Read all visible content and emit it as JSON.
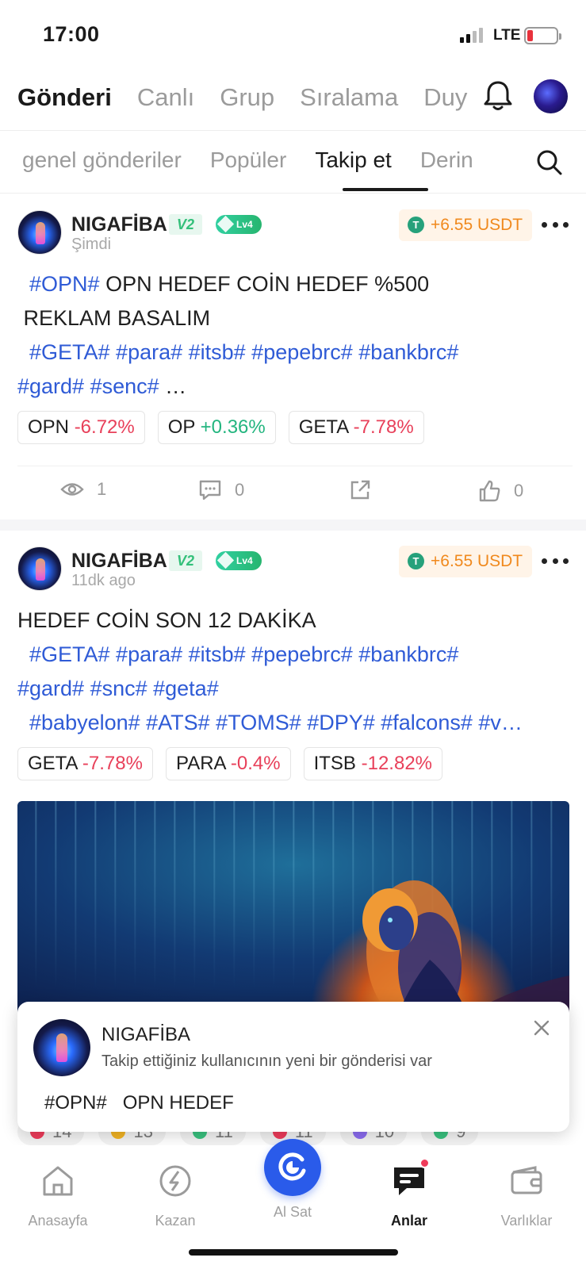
{
  "status_bar": {
    "time": "17:00",
    "network": "LTE"
  },
  "main_tabs": [
    "Gönderi",
    "Canlı",
    "Grup",
    "Sıralama",
    "Duy"
  ],
  "sub_tabs": [
    "genel gönderiler",
    "Popüler",
    "Takip et",
    "Derin"
  ],
  "colors": {
    "accent": "#2a5bea",
    "tag": "#2f5bd6",
    "negative": "#e8405a",
    "positive": "#23b57f",
    "reward": "#f0891d"
  },
  "posts": [
    {
      "author": "NIGAFİBA",
      "badge_v": "V2",
      "badge_lv": "Lv4",
      "time": "Şimdi",
      "reward": "+6.55 USDT",
      "lines": [
        {
          "tag": "#OPN#",
          "text": "   OPN HEDEF COİN HEDEF %500"
        },
        {
          "tag": "",
          "text": "REKLAM BASALIM"
        },
        {
          "tag": "#GETA# #para# #itsb# #pepebrc# #bankbrc#",
          "text": ""
        },
        {
          "tag": "#gard# #senc#",
          "text": "  …"
        }
      ],
      "chips": [
        {
          "symbol": "OPN",
          "change": "-6.72%",
          "direction": "negative"
        },
        {
          "symbol": "OP",
          "change": "+0.36%",
          "direction": "positive"
        },
        {
          "symbol": "GETA",
          "change": "-7.78%",
          "direction": "negative"
        }
      ],
      "views": "1",
      "comments": "0",
      "likes": "0"
    },
    {
      "author": "NIGAFİBA",
      "badge_v": "V2",
      "badge_lv": "Lv4",
      "time": "11dk ago",
      "reward": "+6.55 USDT",
      "lines": [
        {
          "tag": "",
          "text": "HEDEF COİN SON 12 DAKİKA"
        },
        {
          "tag": "#GETA# #para# #itsb# #pepebrc# #bankbrc#",
          "text": ""
        },
        {
          "tag": "#gard# #snc# #geta#",
          "text": ""
        },
        {
          "tag": "#babyelon# #ATS# #TOMS# #DPY# #falcons# #v…",
          "text": ""
        }
      ],
      "chips": [
        {
          "symbol": "GETA",
          "change": "-7.78%",
          "direction": "negative"
        },
        {
          "symbol": "PARA",
          "change": "-0.4%",
          "direction": "negative"
        },
        {
          "symbol": "ITSB",
          "change": "-12.82%",
          "direction": "negative"
        }
      ]
    }
  ],
  "notification": {
    "name": "NIGAFİBA",
    "message": "Takip ettiğiniz kullanıcının yeni bir gönderisi var",
    "snippet_tag": "#OPN#",
    "snippet_text": "OPN HEDEF"
  },
  "reactions": [
    "14",
    "13",
    "11",
    "11",
    "10",
    "9"
  ],
  "bottom_nav": [
    {
      "label": "Anasayfa",
      "icon": "home-icon"
    },
    {
      "label": "Kazan",
      "icon": "earn-icon"
    },
    {
      "label": "Al Sat",
      "icon": "trade-icon"
    },
    {
      "label": "Anlar",
      "icon": "moments-icon"
    },
    {
      "label": "Varlıklar",
      "icon": "wallet-icon"
    }
  ]
}
